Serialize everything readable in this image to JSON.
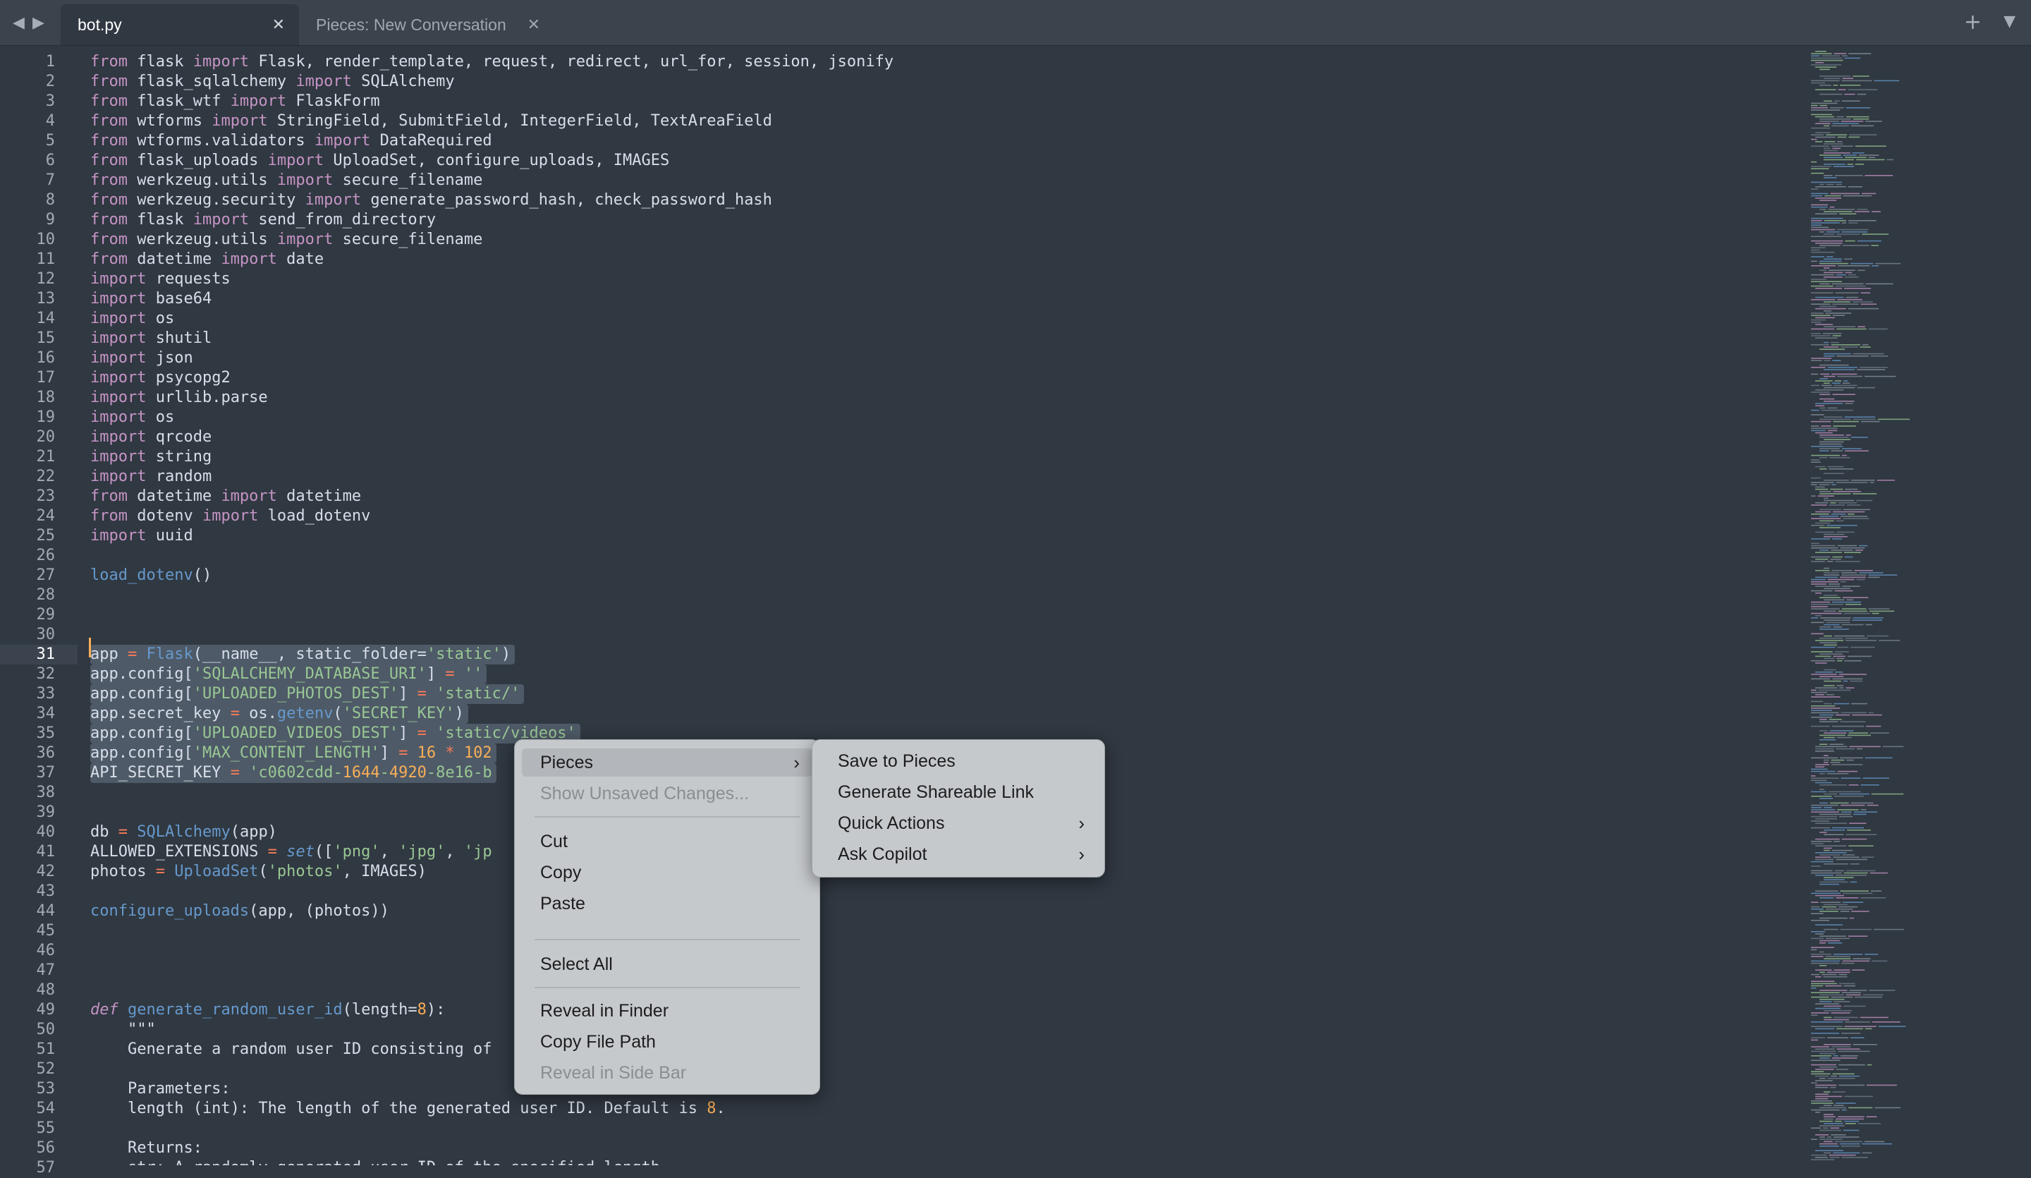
{
  "tabs": [
    {
      "label": "bot.py",
      "active": true
    },
    {
      "label": "Pieces: New Conversation",
      "active": false
    }
  ],
  "tab_close_glyph": "✕",
  "tab_actions": {
    "new_tab_icon": "plus-icon",
    "menu_icon": "triangle-down-icon"
  },
  "editor": {
    "current_line": 31,
    "line_numbers": [
      "1",
      "2",
      "3",
      "4",
      "5",
      "6",
      "7",
      "8",
      "9",
      "10",
      "11",
      "12",
      "13",
      "14",
      "15",
      "16",
      "17",
      "18",
      "19",
      "20",
      "21",
      "22",
      "23",
      "24",
      "25",
      "26",
      "27",
      "28",
      "29",
      "30",
      "31",
      "32",
      "33",
      "34",
      "35",
      "36",
      "37",
      "38",
      "39",
      "40",
      "41",
      "42",
      "43",
      "44",
      "45",
      "46",
      "47",
      "48",
      "49",
      "50",
      "51",
      "52",
      "53",
      "54",
      "55",
      "56",
      "57"
    ],
    "lines": [
      "from flask import Flask, render_template, request, redirect, url_for, session, jsonify",
      "from flask_sqlalchemy import SQLAlchemy",
      "from flask_wtf import FlaskForm",
      "from wtforms import StringField, SubmitField, IntegerField, TextAreaField",
      "from wtforms.validators import DataRequired",
      "from flask_uploads import UploadSet, configure_uploads, IMAGES",
      "from werkzeug.utils import secure_filename",
      "from werkzeug.security import generate_password_hash, check_password_hash",
      "from flask import send_from_directory",
      "from werkzeug.utils import secure_filename",
      "from datetime import date",
      "import requests",
      "import base64",
      "import os",
      "import shutil",
      "import json",
      "import psycopg2",
      "import urllib.parse",
      "import os",
      "import qrcode",
      "import string",
      "import random",
      "from datetime import datetime",
      "from dotenv import load_dotenv",
      "import uuid",
      "",
      "load_dotenv()",
      "",
      "",
      "",
      "app = Flask(__name__, static_folder='static')",
      "app.config['SQLALCHEMY_DATABASE_URI'] = ''",
      "app.config['UPLOADED_PHOTOS_DEST'] = 'static/'",
      "app.secret_key = os.getenv('SECRET_KEY')",
      "app.config['UPLOADED_VIDEOS_DEST'] = 'static/videos'",
      "app.config['MAX_CONTENT_LENGTH'] = 16 * 102",
      "API_SECRET_KEY = 'c0602cdd-1644-4920-8e16-b",
      "",
      "",
      "db = SQLAlchemy(app)",
      "ALLOWED_EXTENSIONS = set(['png', 'jpg', 'jp",
      "photos = UploadSet('photos', IMAGES)",
      "",
      "configure_uploads(app, (photos))",
      "",
      "",
      "",
      "",
      "def generate_random_user_id(length=8):",
      "    \"\"\"",
      "    Generate a random user ID consisting of",
      "",
      "    Parameters:",
      "    length (int): The length of the generated user ID. Default is 8.",
      "",
      "    Returns:",
      "    str: A randomly generated user ID of the specified length."
    ]
  },
  "context_menu": {
    "items": [
      {
        "label": "Pieces",
        "has_submenu": true,
        "highlighted": true,
        "enabled": true
      },
      {
        "label": "Show Unsaved Changes...",
        "enabled": false
      },
      {
        "label": "Cut",
        "enabled": true
      },
      {
        "label": "Copy",
        "enabled": true
      },
      {
        "label": "Paste",
        "enabled": true
      },
      {
        "label": "Select All",
        "enabled": true
      },
      {
        "label": "Reveal in Finder",
        "enabled": true
      },
      {
        "label": "Copy File Path",
        "enabled": true
      },
      {
        "label": "Reveal in Side Bar",
        "enabled": false
      }
    ],
    "submenu_glyph": "›"
  },
  "pieces_submenu": {
    "items": [
      {
        "label": "Save to Pieces",
        "has_submenu": false
      },
      {
        "label": "Generate Shareable Link",
        "has_submenu": false
      },
      {
        "label": "Quick Actions",
        "has_submenu": true
      },
      {
        "label": "Ask Copilot",
        "has_submenu": true
      }
    ]
  },
  "colors": {
    "editor_bg": "#303841",
    "keyword": "#c594c5",
    "function": "#6699cc",
    "string": "#99c794",
    "operator": "#f97b58",
    "number": "#f9ae58",
    "selection": "#4e5a67",
    "menu_bg": "#c6c9cc"
  }
}
